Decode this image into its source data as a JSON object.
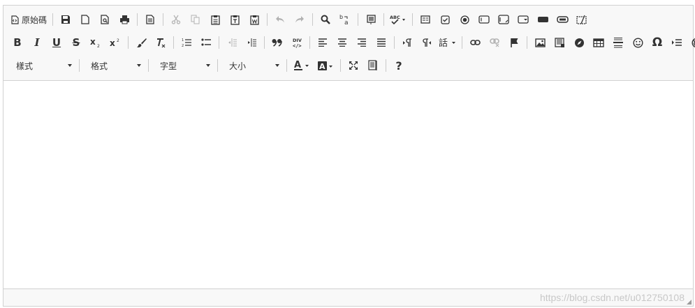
{
  "toolbar": {
    "source_label": "原始碼",
    "styles_label": "樣式",
    "format_label": "格式",
    "font_label": "字型",
    "size_label": "大小",
    "help_label": "?",
    "icon_color": "#333333"
  },
  "watermark": "https://blog.csdn.net/u012750108"
}
